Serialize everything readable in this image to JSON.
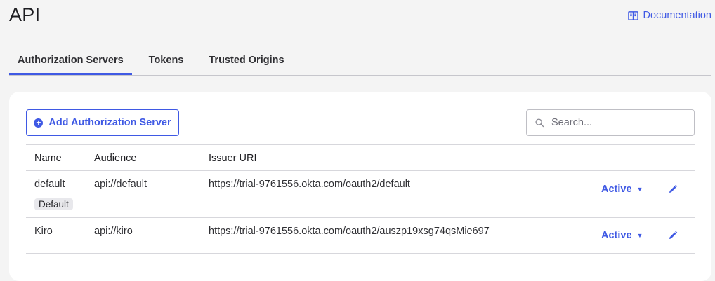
{
  "page": {
    "title": "API"
  },
  "documentation": {
    "label": "Documentation",
    "icon": "book-icon"
  },
  "tabs": [
    {
      "label": "Authorization Servers",
      "active": true
    },
    {
      "label": "Tokens",
      "active": false
    },
    {
      "label": "Trusted Origins",
      "active": false
    }
  ],
  "toolbar": {
    "add_label": "Add Authorization Server",
    "search_placeholder": "Search..."
  },
  "table": {
    "columns": [
      "Name",
      "Audience",
      "Issuer URI"
    ],
    "rows": [
      {
        "name": "default",
        "badge": "Default",
        "audience": "api://default",
        "issuer": "https://trial-9761556.okta.com/oauth2/default",
        "status": "Active"
      },
      {
        "name": "Kiro",
        "audience": "api://kiro",
        "issuer": "https://trial-9761556.okta.com/oauth2/auszp19xsg74qsMie697",
        "status": "Active"
      }
    ]
  },
  "colors": {
    "accent": "#3f59e4",
    "background": "#f4f4f4",
    "card": "#ffffff"
  }
}
